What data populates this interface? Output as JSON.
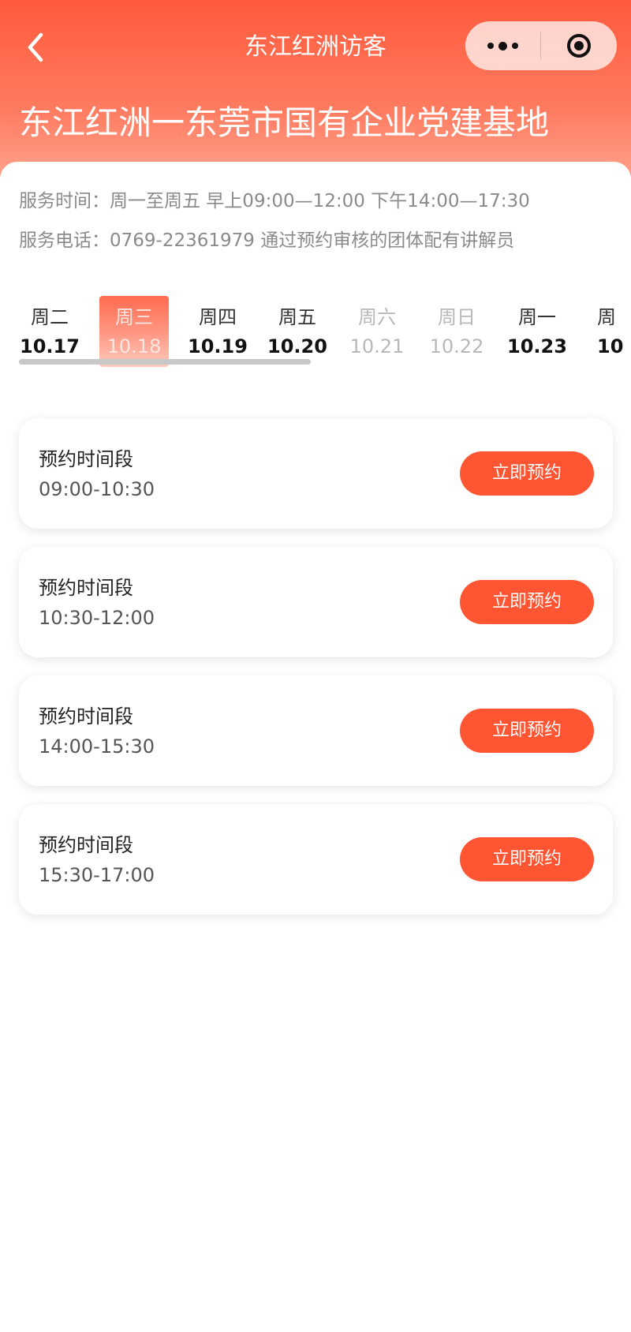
{
  "nav": {
    "title": "东江红洲访客"
  },
  "base_title": "东江红洲一东莞市国有企业党建基地",
  "info": {
    "service_time": "服务时间：周一至周五 早上09:00—12:00 下午14:00—17:30",
    "service_phone": "服务电话：0769-22361979 通过预约审核的团体配有讲解员"
  },
  "dates": [
    {
      "weekday": "周二",
      "date": "10.17"
    },
    {
      "weekday": "周三",
      "date": "10.18"
    },
    {
      "weekday": "周四",
      "date": "10.19"
    },
    {
      "weekday": "周五",
      "date": "10.20"
    },
    {
      "weekday": "周六",
      "date": "10.21"
    },
    {
      "weekday": "周日",
      "date": "10.22"
    },
    {
      "weekday": "周一",
      "date": "10.23"
    },
    {
      "weekday": "周",
      "date": "10"
    }
  ],
  "slots": [
    {
      "label": "预约时间段",
      "time": "09:00-10:30",
      "button": "立即预约"
    },
    {
      "label": "预约时间段",
      "time": "10:30-12:00",
      "button": "立即预约"
    },
    {
      "label": "预约时间段",
      "time": "14:00-15:30",
      "button": "立即预约"
    },
    {
      "label": "预约时间段",
      "time": "15:30-17:00",
      "button": "立即预约"
    }
  ],
  "colors": {
    "brand": "#ff5533",
    "header_top": "#ff5a3c",
    "muted_text": "#8a8a8a",
    "weekend_text": "#b8b8b8"
  },
  "icons": {
    "back": "chevron-left-icon",
    "more": "more-dots-icon",
    "close": "target-circle-icon"
  }
}
